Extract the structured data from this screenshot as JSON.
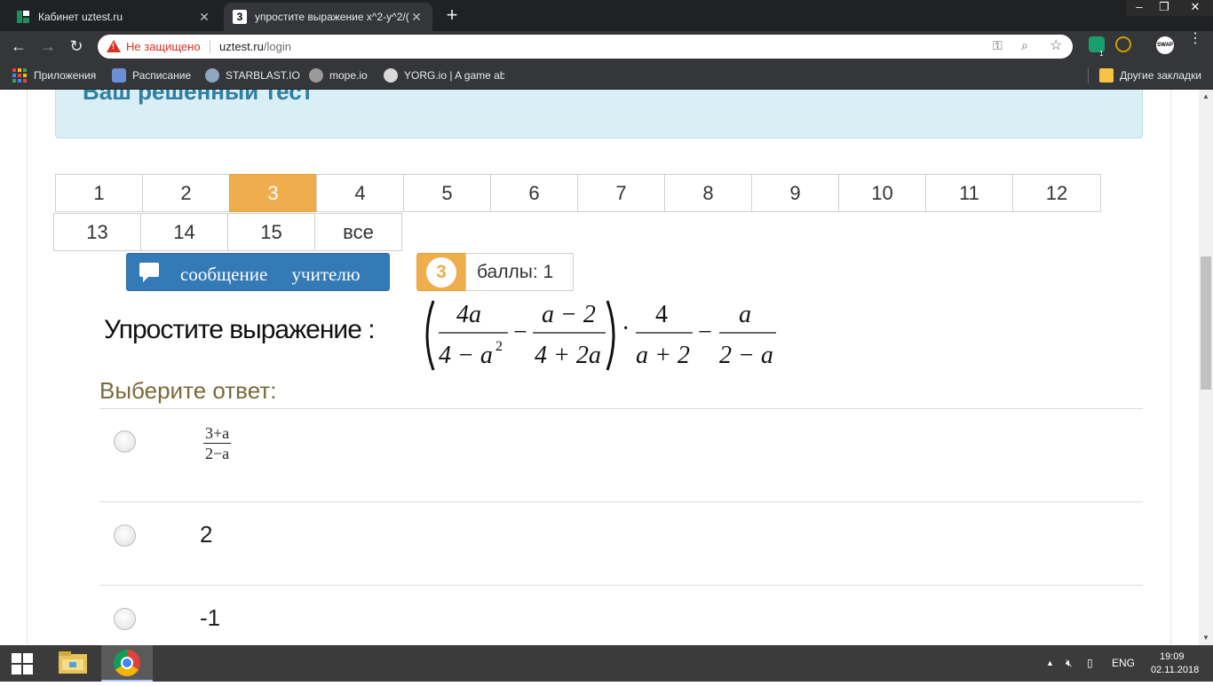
{
  "browser": {
    "tabs": [
      {
        "title": "Кабинет uztest.ru",
        "active": false
      },
      {
        "title": "упростите выражение x^2-y^2/(",
        "active": true,
        "favicon": "3"
      }
    ],
    "window_controls": {
      "minimize": "–",
      "restore": "❐",
      "close": "✕"
    },
    "new_tab": "+",
    "security_text": "Не защищено",
    "url_host": "uztest.ru",
    "url_path": "/login",
    "ext_swap": "SWAP",
    "ext_badge": "1"
  },
  "bookmarks": [
    {
      "label": "Приложения",
      "icon": "apps-grid-icon"
    },
    {
      "label": "Расписание",
      "icon": "chat-icon"
    },
    {
      "label": "STARBLAST.IO",
      "icon": "starblast-icon"
    },
    {
      "label": "mope.io",
      "icon": "mope-icon"
    },
    {
      "label": "YORG.io | A game ab",
      "icon": "yorg-icon"
    },
    {
      "label": "Другие закладки",
      "icon": "folder-icon"
    }
  ],
  "page": {
    "info_title": "Ваш решенный тест",
    "questions": [
      "1",
      "2",
      "3",
      "4",
      "5",
      "6",
      "7",
      "8",
      "9",
      "10",
      "11",
      "12",
      "13",
      "14",
      "15",
      "все"
    ],
    "current_question": "3",
    "message_button": "сообщение учителю",
    "score_badge": "3",
    "score_text": "баллы: 1",
    "task_label": "Упростите выражение :",
    "formula": {
      "f1_num": "4a",
      "f1_den_a": "4 − a",
      "f1_den_exp": "2",
      "minus": "−",
      "f2_num": "a − 2",
      "f2_den": "4 + 2a",
      "dot": "·",
      "f3_num": "4",
      "f3_den": "a + 2",
      "f4_num": "a",
      "f4_den": "2 − a"
    },
    "choose_label": "Выберите ответ:",
    "answers": [
      {
        "type": "fraction",
        "num": "3+a",
        "den": "2−a"
      },
      {
        "type": "text",
        "text": "2"
      },
      {
        "type": "text",
        "text": "-1"
      }
    ]
  },
  "taskbar": {
    "lang": "ENG",
    "time": "19:09",
    "date": "02.11.2018"
  },
  "colors": {
    "accent_orange": "#f0ad4e",
    "button_blue": "#337ab7",
    "info_bg": "#d9eef5",
    "insecure_red": "#d93025"
  }
}
